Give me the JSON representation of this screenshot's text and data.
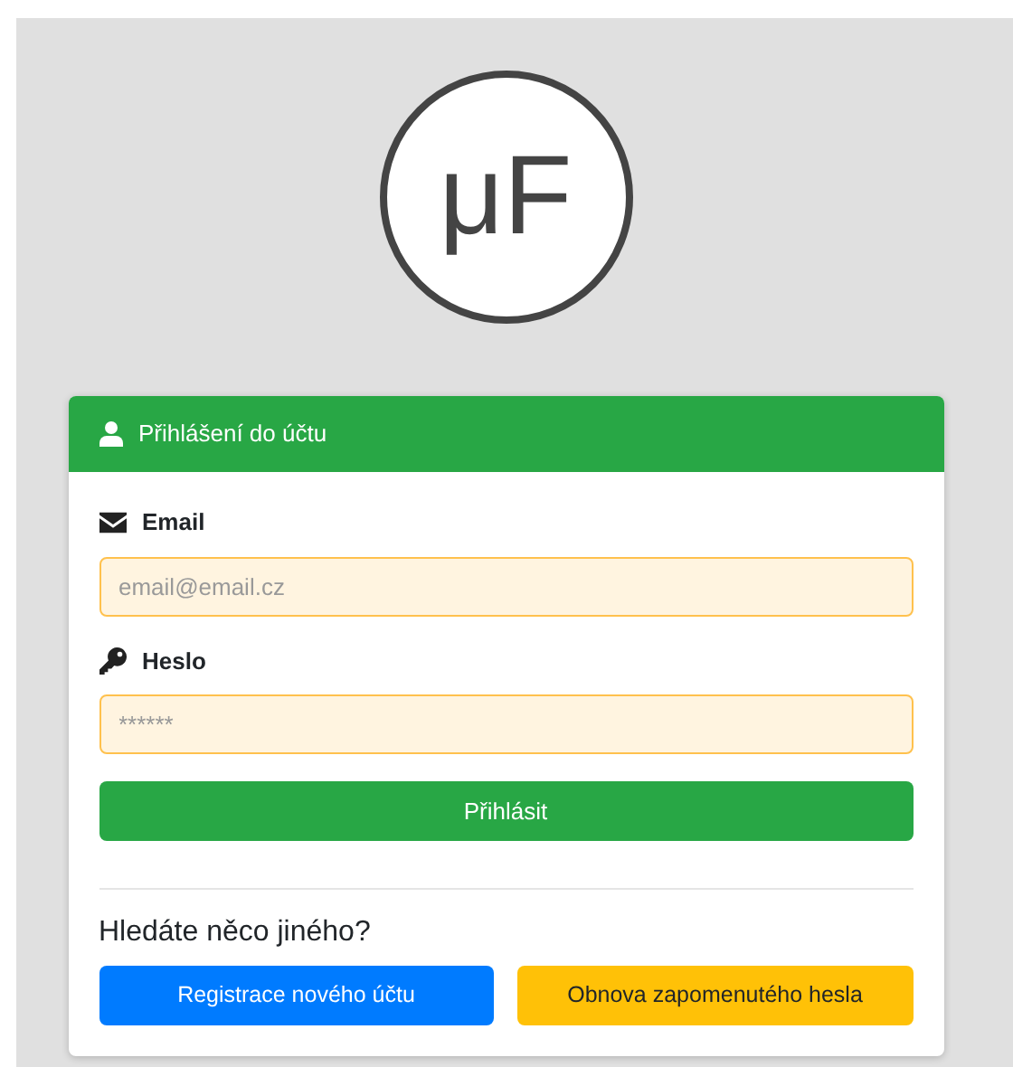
{
  "logo": {
    "text": "μF"
  },
  "card": {
    "title": "Přihlášení do účtu",
    "fields": [
      {
        "label": "Email",
        "kind": "email",
        "placeholder": "email@email.cz"
      },
      {
        "label": "Heslo",
        "kind": "password",
        "placeholder": "******"
      }
    ],
    "submit": "Přihlásit",
    "alt_heading": "Hledáte něco jiného?",
    "alt_buttons": [
      {
        "label": "Registrace nového účtu",
        "kind": "primary"
      },
      {
        "label": "Obnova zapomenutého hesla",
        "kind": "warning"
      }
    ]
  }
}
